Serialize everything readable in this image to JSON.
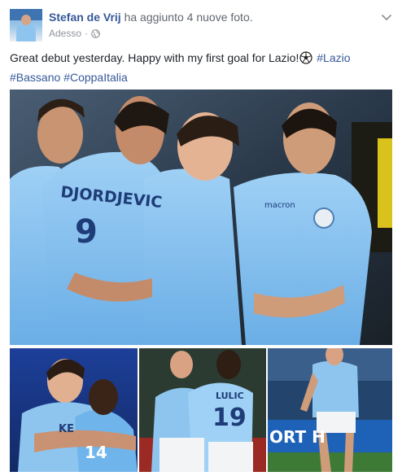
{
  "post": {
    "author": "Stefan de Vrij",
    "action": "ha aggiunto 4 nuove foto.",
    "timestamp": "Adesso",
    "separator": "·",
    "text": "Great debut yesterday. Happy with my first goal for Lazio!",
    "hashtags": [
      "#Lazio",
      "#Bassano",
      "#CoppaItalia"
    ]
  },
  "photos": {
    "main": {
      "jersey_name": "DJORDJEVIC",
      "jersey_number": "9",
      "sponsor": "macron"
    },
    "b": {
      "jersey_name": "LULIC",
      "jersey_number": "19"
    },
    "a": {
      "jersey_name": "KE",
      "jersey_number": "14"
    },
    "c": {
      "banner_text": "ORT H"
    }
  },
  "icons": {
    "avatar": "profile-photo",
    "audience": "globe-icon",
    "menu": "chevron-down-icon",
    "emoji": "soccer-ball-emoji"
  },
  "colors": {
    "link": "#365899",
    "meta": "#90949c",
    "lazio_blue": "#8ec5ef"
  }
}
